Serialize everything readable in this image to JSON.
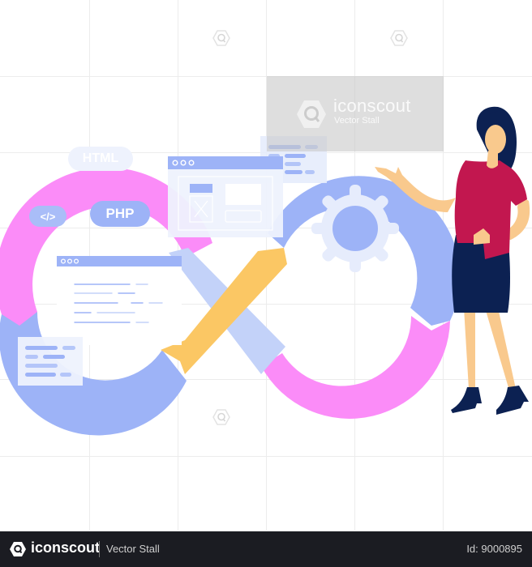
{
  "illustration": {
    "title": "DevOps infinity loop with presenter",
    "tags": {
      "html": "HTML",
      "php": "PHP",
      "code": "</>"
    },
    "colors": {
      "pink": "#fb8cf8",
      "periwinkle": "#9db3f7",
      "light_blue": "#c3d2f9",
      "yellow": "#fbc764",
      "panel": "#e8eefc",
      "shirt": "#c2174f",
      "skirt": "#0c2152",
      "skin": "#f9c98d"
    }
  },
  "watermark": {
    "brand": "iconscout",
    "subtitle": "Vector Stall"
  },
  "footer": {
    "brand": "iconscout",
    "author": "Vector Stall",
    "id_label": "Id: 9000895"
  }
}
